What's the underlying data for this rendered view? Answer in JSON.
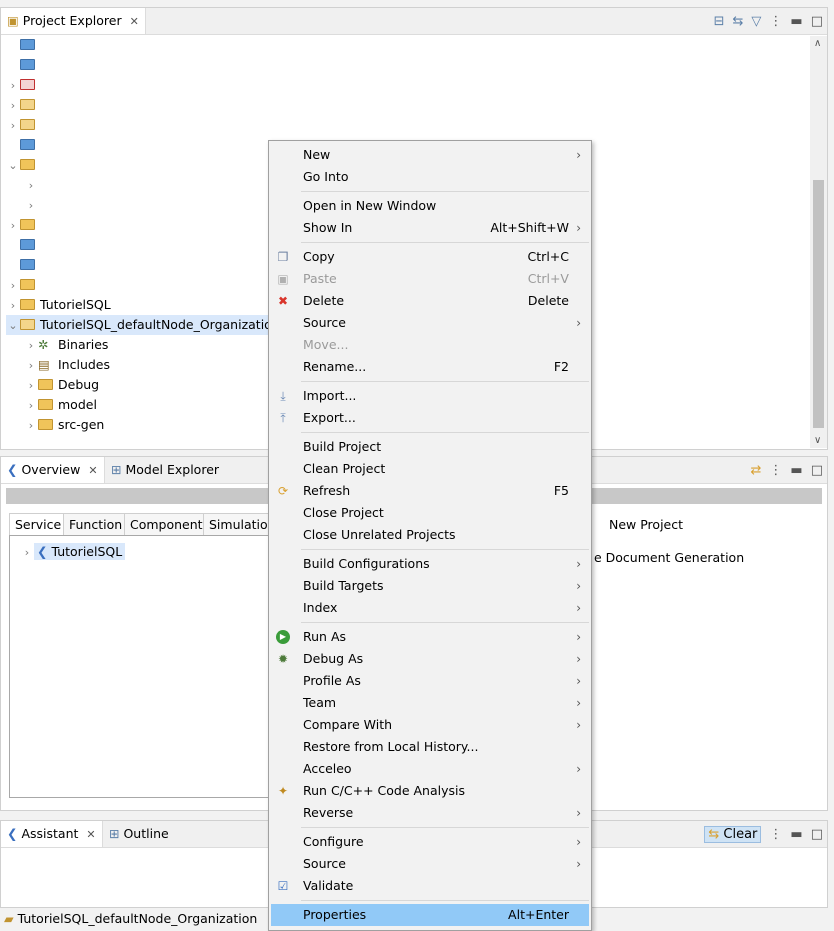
{
  "project_explorer": {
    "tab_label": "Project Explorer",
    "close": "✕",
    "rows": [
      {
        "label": "",
        "chev": "",
        "icon": "folder"
      },
      {
        "label": "",
        "chev": "",
        "icon": "folder"
      },
      {
        "label": "",
        "chev": "›",
        "icon": "cproj-err"
      },
      {
        "label": "",
        "chev": "›",
        "icon": "cproj"
      },
      {
        "label": "",
        "chev": "›",
        "icon": "cproj"
      },
      {
        "label": "",
        "chev": "",
        "icon": "folder"
      },
      {
        "label": "",
        "chev": "⌄",
        "icon": "open"
      },
      {
        "label": "",
        "chev": "›",
        "icon": ""
      },
      {
        "label": "",
        "chev": "›",
        "icon": ""
      },
      {
        "label": "",
        "chev": "›",
        "icon": "open"
      },
      {
        "label": "",
        "chev": "",
        "icon": "folder"
      },
      {
        "label": "",
        "chev": "",
        "icon": "folder"
      },
      {
        "label": "",
        "chev": "›",
        "icon": "open"
      },
      {
        "label": "TutorielSQL",
        "chev": "›",
        "icon": "open"
      },
      {
        "label": "TutorielSQL_defaultNode_Organization",
        "chev": "⌄",
        "icon": "proj"
      },
      {
        "label": "Binaries",
        "chev": "›",
        "icon": "bin"
      },
      {
        "label": "Includes",
        "chev": "›",
        "icon": "inc"
      },
      {
        "label": "Debug",
        "chev": "›",
        "icon": "open"
      },
      {
        "label": "model",
        "chev": "›",
        "icon": "open"
      },
      {
        "label": "src-gen",
        "chev": "›",
        "icon": "open"
      }
    ]
  },
  "overview": {
    "tab_label": "Overview",
    "tab2_label": "Model Explorer",
    "close": "✕",
    "subtabs": [
      "Service",
      "Function",
      "Component",
      "Simulation"
    ],
    "tree_item": "TutorielSQL",
    "right_items": [
      "New Project",
      "e Document Generation"
    ]
  },
  "assistant": {
    "tab_label": "Assistant",
    "tab2_label": "Outline",
    "close": "✕",
    "clear_label": "Clear"
  },
  "status_bar": {
    "text": "TutorielSQL_defaultNode_Organization"
  },
  "context_menu": {
    "items": [
      {
        "label": "New",
        "accel": "",
        "arrow": true,
        "icon": ""
      },
      {
        "label": "Go Into",
        "accel": "",
        "arrow": false,
        "icon": ""
      },
      {
        "sep": true
      },
      {
        "label": "Open in New Window",
        "accel": "",
        "arrow": false,
        "icon": ""
      },
      {
        "label": "Show In",
        "accel": "Alt+Shift+W",
        "arrow": true,
        "icon": ""
      },
      {
        "sep": true
      },
      {
        "label": "Copy",
        "accel": "Ctrl+C",
        "arrow": false,
        "icon": "copy"
      },
      {
        "label": "Paste",
        "accel": "Ctrl+V",
        "arrow": false,
        "icon": "paste",
        "disabled": true
      },
      {
        "label": "Delete",
        "accel": "Delete",
        "arrow": false,
        "icon": "delete"
      },
      {
        "label": "Source",
        "accel": "",
        "arrow": true,
        "icon": ""
      },
      {
        "label": "Move...",
        "accel": "",
        "arrow": false,
        "icon": "",
        "disabled": true
      },
      {
        "label": "Rename...",
        "accel": "F2",
        "arrow": false,
        "icon": ""
      },
      {
        "sep": true
      },
      {
        "label": "Import...",
        "accel": "",
        "arrow": false,
        "icon": "import"
      },
      {
        "label": "Export...",
        "accel": "",
        "arrow": false,
        "icon": "export"
      },
      {
        "sep": true
      },
      {
        "label": "Build Project",
        "accel": "",
        "arrow": false,
        "icon": ""
      },
      {
        "label": "Clean Project",
        "accel": "",
        "arrow": false,
        "icon": ""
      },
      {
        "label": "Refresh",
        "accel": "F5",
        "arrow": false,
        "icon": "refresh"
      },
      {
        "label": "Close Project",
        "accel": "",
        "arrow": false,
        "icon": ""
      },
      {
        "label": "Close Unrelated Projects",
        "accel": "",
        "arrow": false,
        "icon": ""
      },
      {
        "sep": true
      },
      {
        "label": "Build Configurations",
        "accel": "",
        "arrow": true,
        "icon": ""
      },
      {
        "label": "Build Targets",
        "accel": "",
        "arrow": true,
        "icon": ""
      },
      {
        "label": "Index",
        "accel": "",
        "arrow": true,
        "icon": ""
      },
      {
        "sep": true
      },
      {
        "label": "Run As",
        "accel": "",
        "arrow": true,
        "icon": "run"
      },
      {
        "label": "Debug As",
        "accel": "",
        "arrow": true,
        "icon": "debug"
      },
      {
        "label": "Profile As",
        "accel": "",
        "arrow": true,
        "icon": ""
      },
      {
        "label": "Team",
        "accel": "",
        "arrow": true,
        "icon": ""
      },
      {
        "label": "Compare With",
        "accel": "",
        "arrow": true,
        "icon": ""
      },
      {
        "label": "Restore from Local History...",
        "accel": "",
        "arrow": false,
        "icon": ""
      },
      {
        "label": "Acceleo",
        "accel": "",
        "arrow": true,
        "icon": ""
      },
      {
        "label": "Run C/C++ Code Analysis",
        "accel": "",
        "arrow": false,
        "icon": "analysis"
      },
      {
        "label": "Reverse",
        "accel": "",
        "arrow": true,
        "icon": ""
      },
      {
        "sep": true
      },
      {
        "label": "Configure",
        "accel": "",
        "arrow": true,
        "icon": ""
      },
      {
        "label": "Source",
        "accel": "",
        "arrow": true,
        "icon": ""
      },
      {
        "label": "Validate",
        "accel": "",
        "arrow": false,
        "icon": "check"
      },
      {
        "sep": true
      },
      {
        "label": "Properties",
        "accel": "Alt+Enter",
        "arrow": false,
        "icon": "",
        "highlight": true
      }
    ]
  },
  "colors": {
    "highlight": "#91c9f7",
    "selection": "#d9e8fb",
    "accent_icon": "#5b7fa8"
  }
}
